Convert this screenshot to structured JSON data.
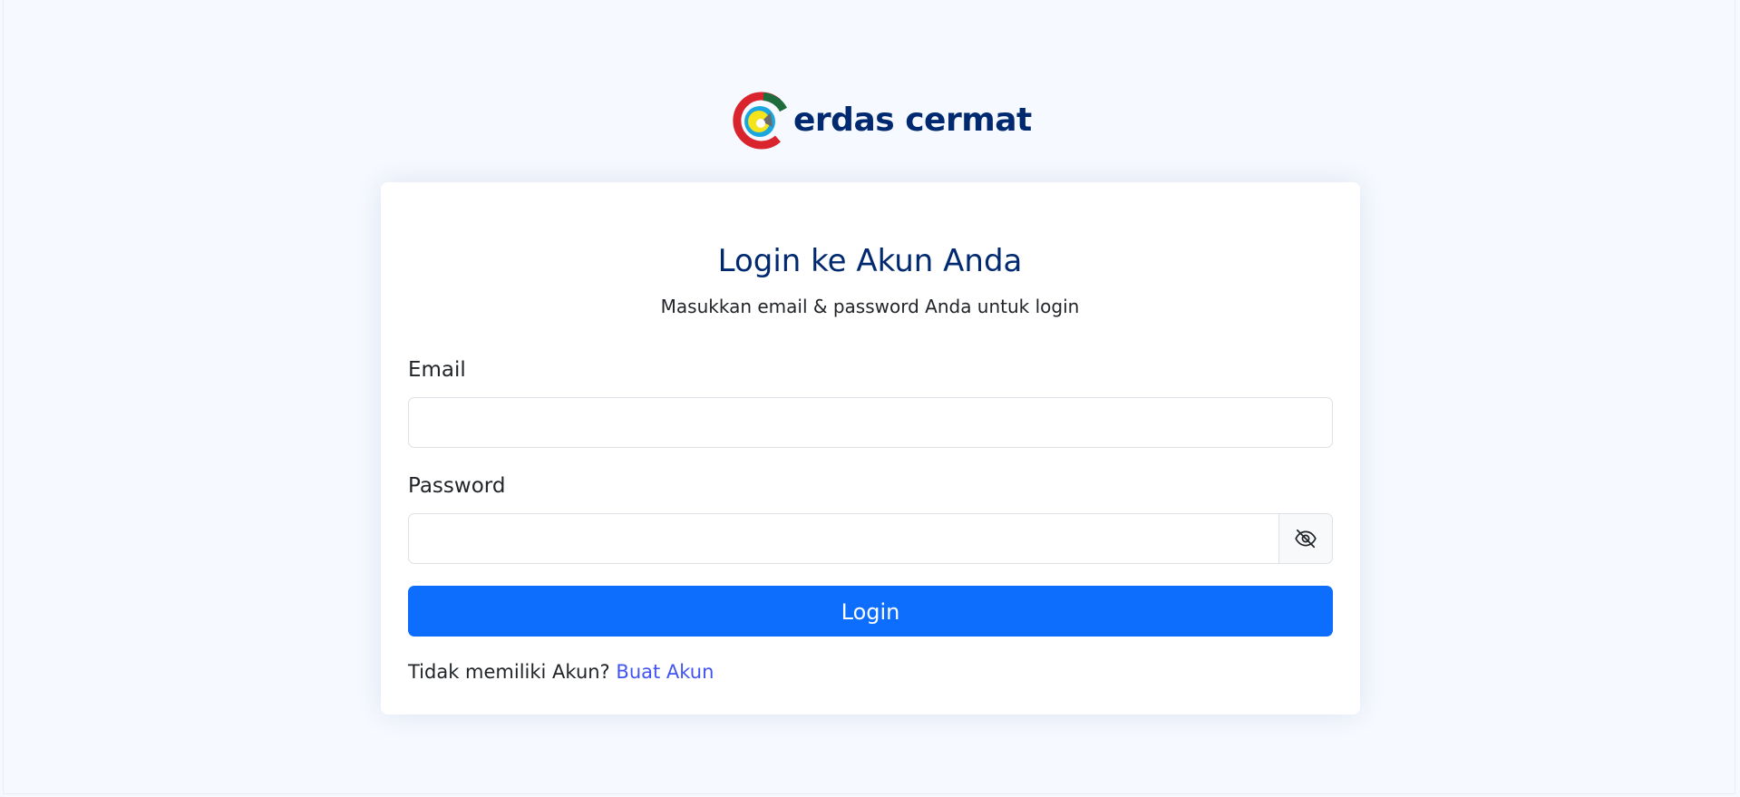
{
  "brand": {
    "name": "erdas cermat",
    "color": "#012970"
  },
  "login": {
    "title": "Login ke Akun Anda",
    "subtitle": "Masukkan email & password Anda untuk login",
    "email_label": "Email",
    "email_value": "",
    "password_label": "Password",
    "password_value": "",
    "password_toggle_icon": "eye-slash-icon",
    "submit_label": "Login",
    "signup_prompt": "Tidak memiliki Akun?",
    "signup_link": "Buat Akun"
  },
  "colors": {
    "primary": "#0d6efd",
    "link": "#4154f1",
    "background": "#f6f9ff"
  }
}
